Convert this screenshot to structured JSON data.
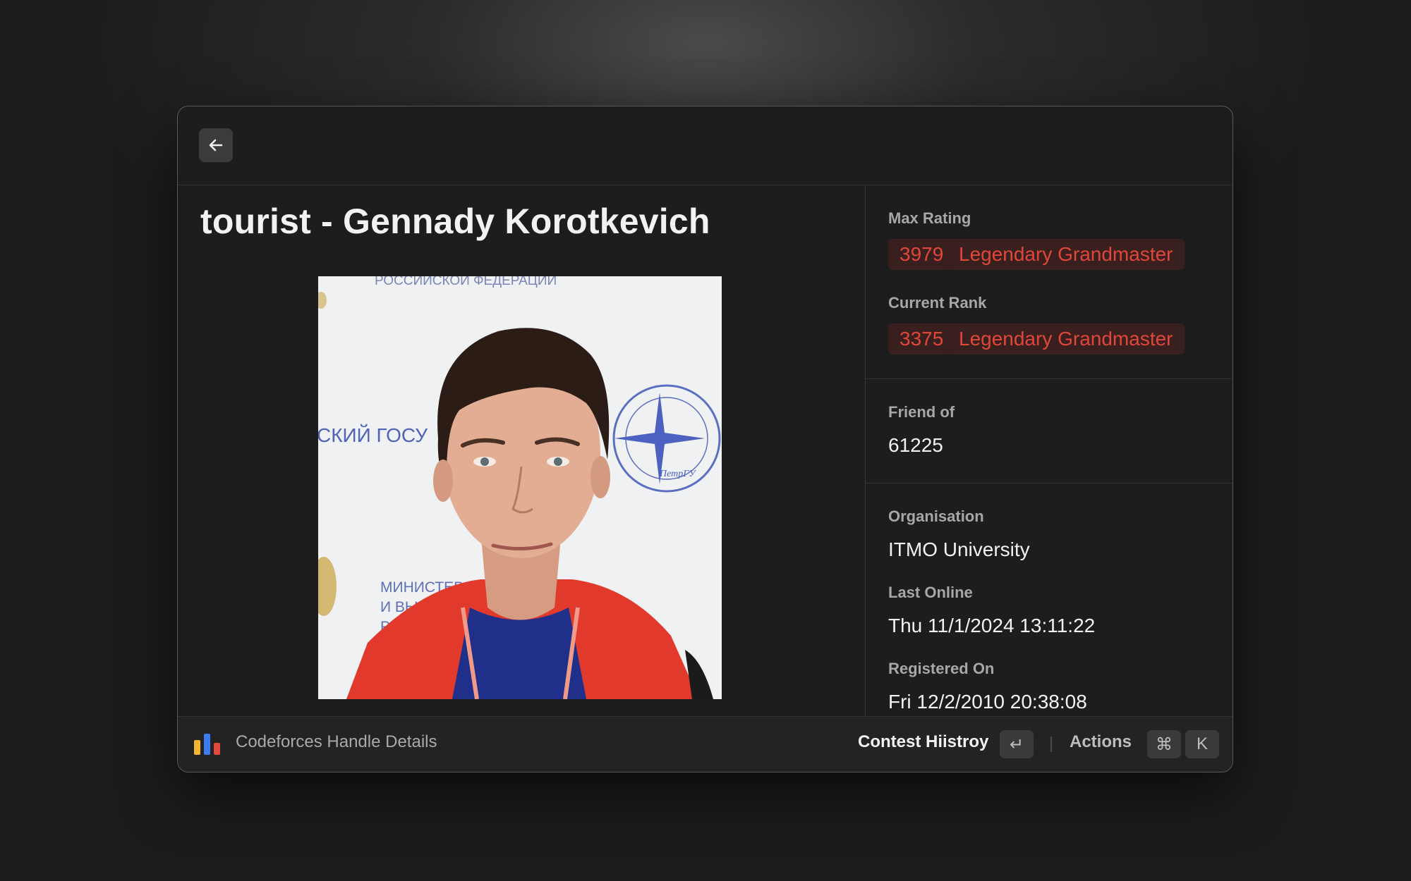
{
  "header": {
    "back_icon": "arrow-left-icon"
  },
  "profile": {
    "title": "tourist - Gennady Korotkevich",
    "photo_signage": {
      "top": "РОССИЙСКОЙ ФЕДЕРАЦИИ",
      "left": "СКИЙ ГОСУ",
      "bottom1": "МИНИСТЕРС",
      "bottom2": "И ВЫСШЕГО",
      "bottom3": "РОССИЙС",
      "seal": "ПетрГУ"
    }
  },
  "details": {
    "max_rating": {
      "label": "Max Rating",
      "value": "3979",
      "rank": "Legendary Grandmaster"
    },
    "current_rank": {
      "label": "Current Rank",
      "value": "3375",
      "rank": "Legendary Grandmaster"
    },
    "friend_of": {
      "label": "Friend of",
      "value": "61225"
    },
    "organisation": {
      "label": "Organisation",
      "value": "ITMO University"
    },
    "last_online": {
      "label": "Last Online",
      "value": "Thu 11/1/2024 13:11:22"
    },
    "registered_on": {
      "label": "Registered On",
      "value": "Fri 12/2/2010 20:38:08"
    }
  },
  "footer": {
    "app_icon": "bar-chart-icon",
    "app_name": "Codeforces Handle Details",
    "primary_action": "Contest Hiistroy",
    "primary_key": "↵",
    "actions_label": "Actions",
    "actions_key_1": "⌘",
    "actions_key_2": "K"
  },
  "colors": {
    "rank_text": "#e0473a",
    "rank_bg": "#3a1f1f",
    "icon_yellow": "#f2b632",
    "icon_blue": "#3d7bf0",
    "icon_red": "#e04a3b"
  }
}
